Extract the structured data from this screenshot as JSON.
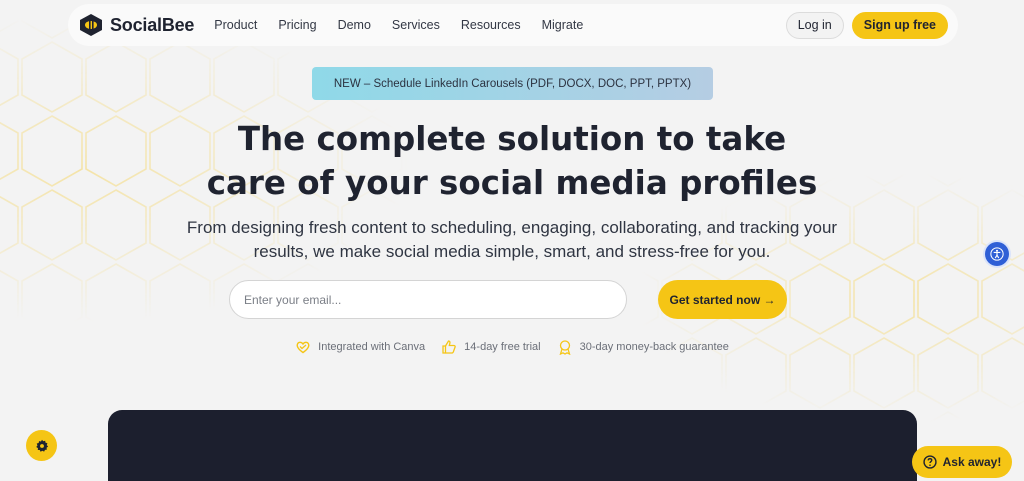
{
  "brand": {
    "name": "SocialBee",
    "accent": "#f5c515",
    "dark": "#1c1f2e"
  },
  "nav": {
    "links": [
      "Product",
      "Pricing",
      "Demo",
      "Services",
      "Resources",
      "Migrate"
    ],
    "login": "Log in",
    "signup": "Sign up free"
  },
  "announcement": "NEW – Schedule LinkedIn Carousels (PDF, DOCX, DOC, PPT, PPTX)",
  "hero": {
    "title_line1": "The complete solution to take",
    "title_line2": "care of your social media profiles",
    "sub_line1": "From designing fresh content to scheduling, engaging, collaborating, and tracking your",
    "sub_line2": "results, we make social media simple, smart, and stress-free for you."
  },
  "form": {
    "email_placeholder": "Enter your email...",
    "cta": "Get started now →"
  },
  "features": [
    {
      "icon": "canva-heart-icon",
      "label": "Integrated with Canva"
    },
    {
      "icon": "thumbs-up-icon",
      "label": "14-day free trial"
    },
    {
      "icon": "badge-icon",
      "label": "30-day money-back guarantee"
    }
  ],
  "chat": {
    "label": "Ask away!",
    "icon": "question-icon"
  },
  "widgets": {
    "settings_icon": "gear-icon",
    "accessibility_icon": "accessibility-icon"
  }
}
